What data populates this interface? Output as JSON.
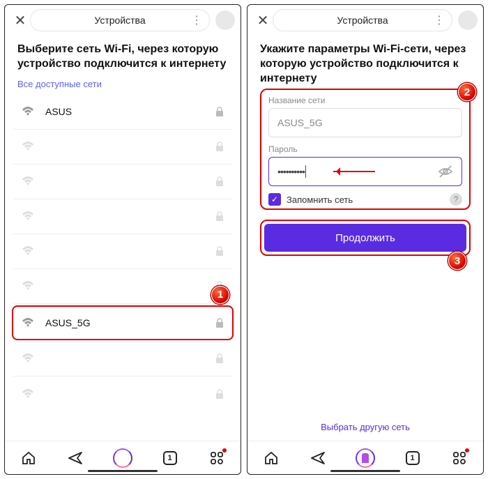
{
  "header": {
    "title": "Устройства"
  },
  "left": {
    "heading": "Выберите сеть Wi-Fi, через которую устройство подключится к интернету",
    "subhead": "Все доступные сети",
    "networks": [
      {
        "name": "ASUS",
        "visible": true
      },
      {
        "name": "",
        "visible": false
      },
      {
        "name": "",
        "visible": false
      },
      {
        "name": "",
        "visible": false
      },
      {
        "name": "",
        "visible": false
      },
      {
        "name": "",
        "visible": false
      },
      {
        "name": "ASUS_5G",
        "visible": true
      },
      {
        "name": "",
        "visible": false
      },
      {
        "name": "",
        "visible": false
      }
    ]
  },
  "right": {
    "heading": "Укажите параметры Wi-Fi-сети, через которую устройство подключится к интернету",
    "name_label": "Название сети",
    "name_value": "ASUS_5G",
    "password_label": "Пароль",
    "password_value": "••••••••••",
    "remember_label": "Запомнить сеть",
    "continue_label": "Продолжить",
    "choose_link": "Выбрать другую сеть"
  },
  "bottombar": {
    "tab_count": "1"
  },
  "badges": {
    "b1": "1",
    "b2": "2",
    "b3": "3"
  }
}
